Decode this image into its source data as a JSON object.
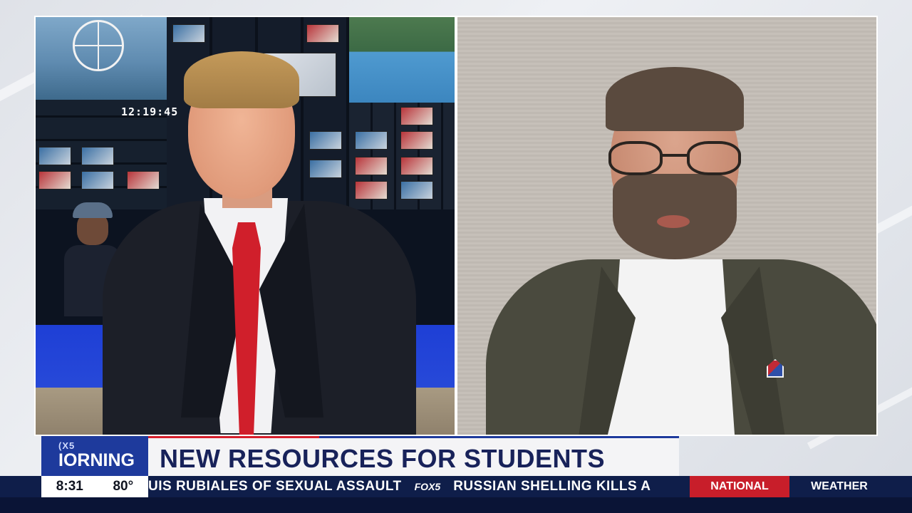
{
  "monitor_clock": "12:19:45",
  "branding": {
    "logo_top": "(X5",
    "logo_main": "IORNING",
    "colors": {
      "brand_blue": "#1e3a9c",
      "accent_red": "#d61f2c",
      "ticker_navy": "#0f1e4a"
    }
  },
  "headline": "NEW RESOURCES FOR STUDENTS",
  "status_bar": {
    "time": "8:31",
    "temperature": "80°"
  },
  "ticker": {
    "item_1": "UIS RUBIALES OF SEXUAL ASSAULT",
    "separator_logo": "FOX5",
    "item_2": "RUSSIAN SHELLING KILLS A"
  },
  "tags": {
    "national": "NATIONAL",
    "weather": "WEATHER"
  },
  "icons": {
    "ferris_wheel": "ferris-wheel-icon",
    "flag_pin": "flag-pin-icon"
  }
}
